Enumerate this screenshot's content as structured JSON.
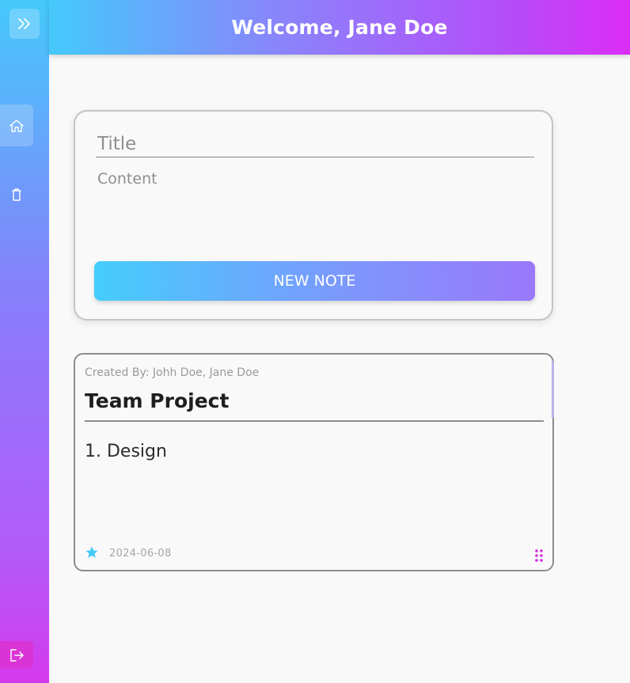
{
  "header": {
    "title": "Welcome, Jane Doe"
  },
  "sidebar": {
    "expand_icon": "chevrons-right-icon",
    "items": [
      {
        "icon": "home-icon",
        "active": true
      },
      {
        "icon": "trash-icon",
        "active": false
      }
    ],
    "logout_icon": "logout-icon"
  },
  "composer": {
    "title_placeholder": "Title",
    "content_placeholder": "Content",
    "button_label": "NEW NOTE"
  },
  "notes": [
    {
      "created_by": "Created By: Johh Doe, Jane Doe",
      "title": "Team Project",
      "body": "1. Design",
      "date": "2024-06-08",
      "starred": true
    }
  ],
  "colors": {
    "accent_cyan": "#45c9fb",
    "accent_purple": "#b25cf9",
    "accent_magenta": "#dc2cf8",
    "star": "#45c9fb",
    "drag_handle": "#d32ce0"
  }
}
